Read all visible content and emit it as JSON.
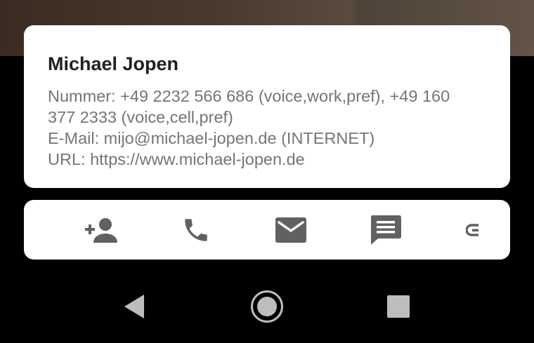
{
  "contact": {
    "name": "Michael Jopen",
    "phone_line_1": "Nummer: +49 2232 566 686 (voice,work,pref), +49 160",
    "phone_line_2": "377 2333 (voice,cell,pref)",
    "email_line": "E-Mail: mijo@michael-jopen.de (INTERNET)",
    "url_line": "URL: https://www.michael-jopen.de"
  },
  "actions": [
    {
      "icon": "add-contact-icon"
    },
    {
      "icon": "phone-icon"
    },
    {
      "icon": "email-icon"
    },
    {
      "icon": "message-icon"
    },
    {
      "icon": "open-url-icon"
    }
  ],
  "navigation": {
    "back_icon": "back-icon",
    "home_icon": "home-icon",
    "recents_icon": "recents-icon"
  },
  "colors": {
    "card_background": "#ffffff",
    "name_text": "#212121",
    "detail_text": "#757575",
    "action_icon": "#616161",
    "nav_icon": "#bdbdbd",
    "screen_background": "#000000"
  }
}
